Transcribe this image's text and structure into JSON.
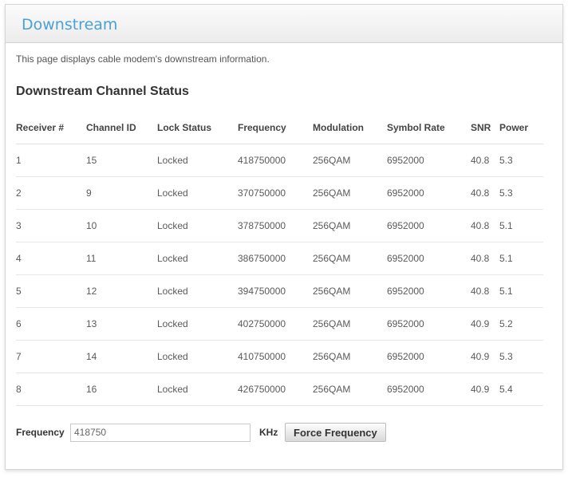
{
  "page": {
    "title": "Downstream",
    "description": "This page displays cable modem's downstream information."
  },
  "channel_status": {
    "title": "Downstream Channel Status",
    "columns": [
      "Receiver #",
      "Channel ID",
      "Lock Status",
      "Frequency",
      "Modulation",
      "Symbol Rate",
      "SNR",
      "Power"
    ],
    "rows": [
      [
        "1",
        "15",
        "Locked",
        "418750000",
        "256QAM",
        "6952000",
        "40.8",
        "5.3"
      ],
      [
        "2",
        "9",
        "Locked",
        "370750000",
        "256QAM",
        "6952000",
        "40.8",
        "5.3"
      ],
      [
        "3",
        "10",
        "Locked",
        "378750000",
        "256QAM",
        "6952000",
        "40.8",
        "5.1"
      ],
      [
        "4",
        "11",
        "Locked",
        "386750000",
        "256QAM",
        "6952000",
        "40.8",
        "5.1"
      ],
      [
        "5",
        "12",
        "Locked",
        "394750000",
        "256QAM",
        "6952000",
        "40.8",
        "5.1"
      ],
      [
        "6",
        "13",
        "Locked",
        "402750000",
        "256QAM",
        "6952000",
        "40.9",
        "5.2"
      ],
      [
        "7",
        "14",
        "Locked",
        "410750000",
        "256QAM",
        "6952000",
        "40.9",
        "5.3"
      ],
      [
        "8",
        "16",
        "Locked",
        "426750000",
        "256QAM",
        "6952000",
        "40.9",
        "5.4"
      ]
    ]
  },
  "frequency_form": {
    "label": "Frequency",
    "value": "418750",
    "unit": "KHz",
    "button_label": "Force Frequency"
  },
  "colors": {
    "title_accent": "#4aa1d3"
  }
}
